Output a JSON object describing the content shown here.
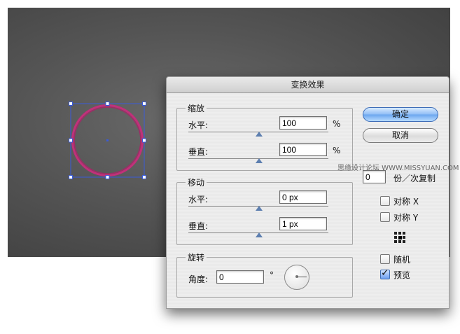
{
  "dialog": {
    "title": "变换效果",
    "scale": {
      "title": "缩放",
      "horizontal_label": "水平:",
      "horizontal_value": "100",
      "vertical_label": "垂直:",
      "vertical_value": "100",
      "unit": "%"
    },
    "move": {
      "title": "移动",
      "horizontal_label": "水平:",
      "horizontal_value": "0 px",
      "vertical_label": "垂直:",
      "vertical_value": "1 px"
    },
    "rotate": {
      "title": "旋转",
      "angle_label": "角度:",
      "angle_value": "0",
      "degree_symbol": "°"
    },
    "buttons": {
      "ok": "确定",
      "cancel": "取消"
    },
    "copies": {
      "value": "0",
      "label": "份／次复制"
    },
    "options": {
      "reflect_x": "对称 X",
      "reflect_y": "对称 Y",
      "random": "随机",
      "preview": "预览",
      "preview_checked": true
    }
  },
  "watermark": "思缘设计论坛 WWW.MISSYUAN.COM",
  "colors": {
    "canvas": "#555555",
    "circle_stroke": "#c1307a",
    "selection": "#3a5bd9",
    "primary_button": "#6aa5ee"
  }
}
